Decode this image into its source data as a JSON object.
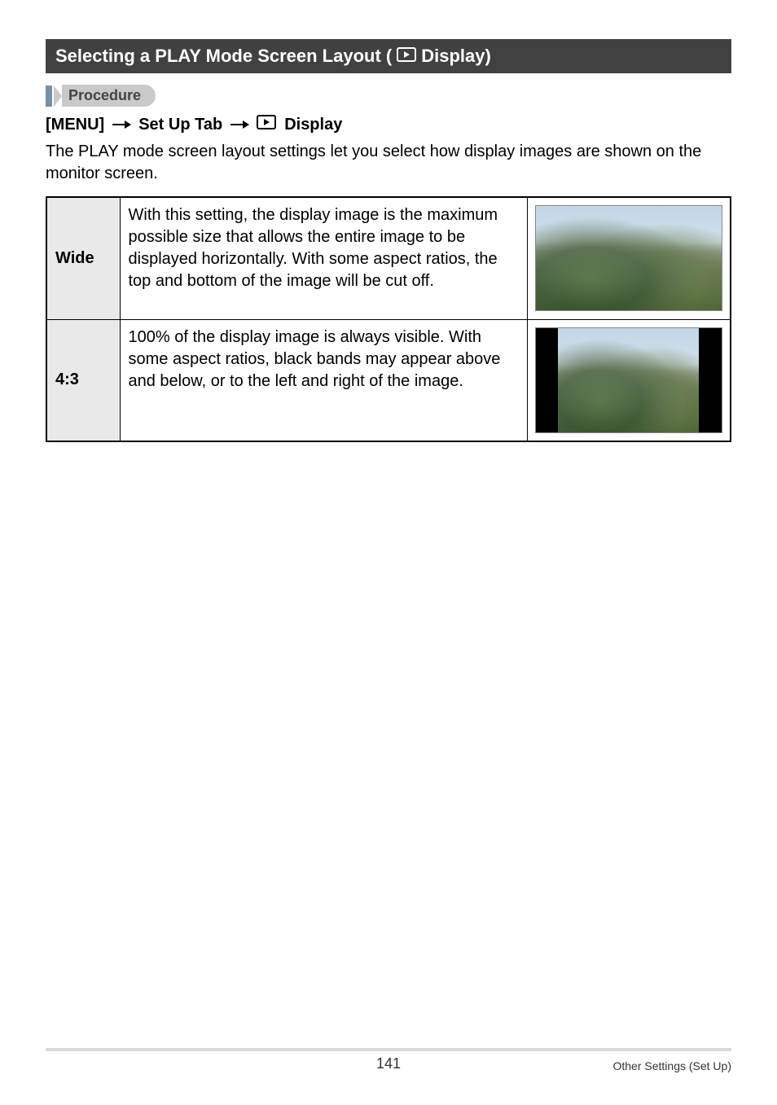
{
  "heading": {
    "prefix": "Selecting a PLAY Mode Screen Layout (",
    "icon": "play-icon",
    "suffix": " Display)"
  },
  "procedure_label": "Procedure",
  "breadcrumb": {
    "step1": "[MENU]",
    "step2": "Set Up Tab",
    "icon": "play-icon",
    "step3": " Display"
  },
  "intro": "The PLAY mode screen layout settings let you select how display images are shown on the monitor screen.",
  "options": [
    {
      "name": "Wide",
      "desc": "With this setting, the display image is the maximum possible size that allows the entire image to be displayed horizontally. With some aspect ratios, the top and bottom of the image will be cut off.",
      "thumb": "wide"
    },
    {
      "name": "4:3",
      "desc": "100% of the display image is always visible. With some aspect ratios, black bands may appear above and below, or to the left and right of the image.",
      "thumb": "43"
    }
  ],
  "footer": {
    "page": "141",
    "section": "Other Settings (Set Up)"
  }
}
